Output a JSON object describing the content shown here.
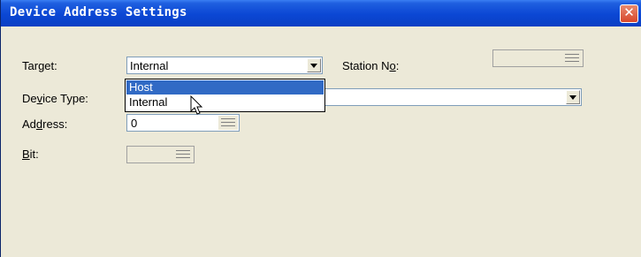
{
  "window": {
    "title": "Device Address Settings",
    "close_glyph": "✕"
  },
  "target": {
    "label_pre": "Tar",
    "label_u": "g",
    "label_post": "et:",
    "value": "Internal",
    "options": [
      {
        "label": "Host",
        "selected": true
      },
      {
        "label": "Internal",
        "selected": false
      }
    ]
  },
  "station_no": {
    "label_pre": "Station N",
    "label_u": "o",
    "label_post": ":",
    "value": ""
  },
  "device_type": {
    "label_pre": "De",
    "label_u": "v",
    "label_post": "ice Type:",
    "value": ""
  },
  "address": {
    "label_pre": "Ad",
    "label_u": "d",
    "label_post": "ress:",
    "value": "0"
  },
  "bit": {
    "label_u": "B",
    "label_post": "it:",
    "value": ""
  },
  "colors": {
    "title_bar": "#0b47d4",
    "dialog_bg": "#ece9d8",
    "selection": "#316ac5"
  }
}
